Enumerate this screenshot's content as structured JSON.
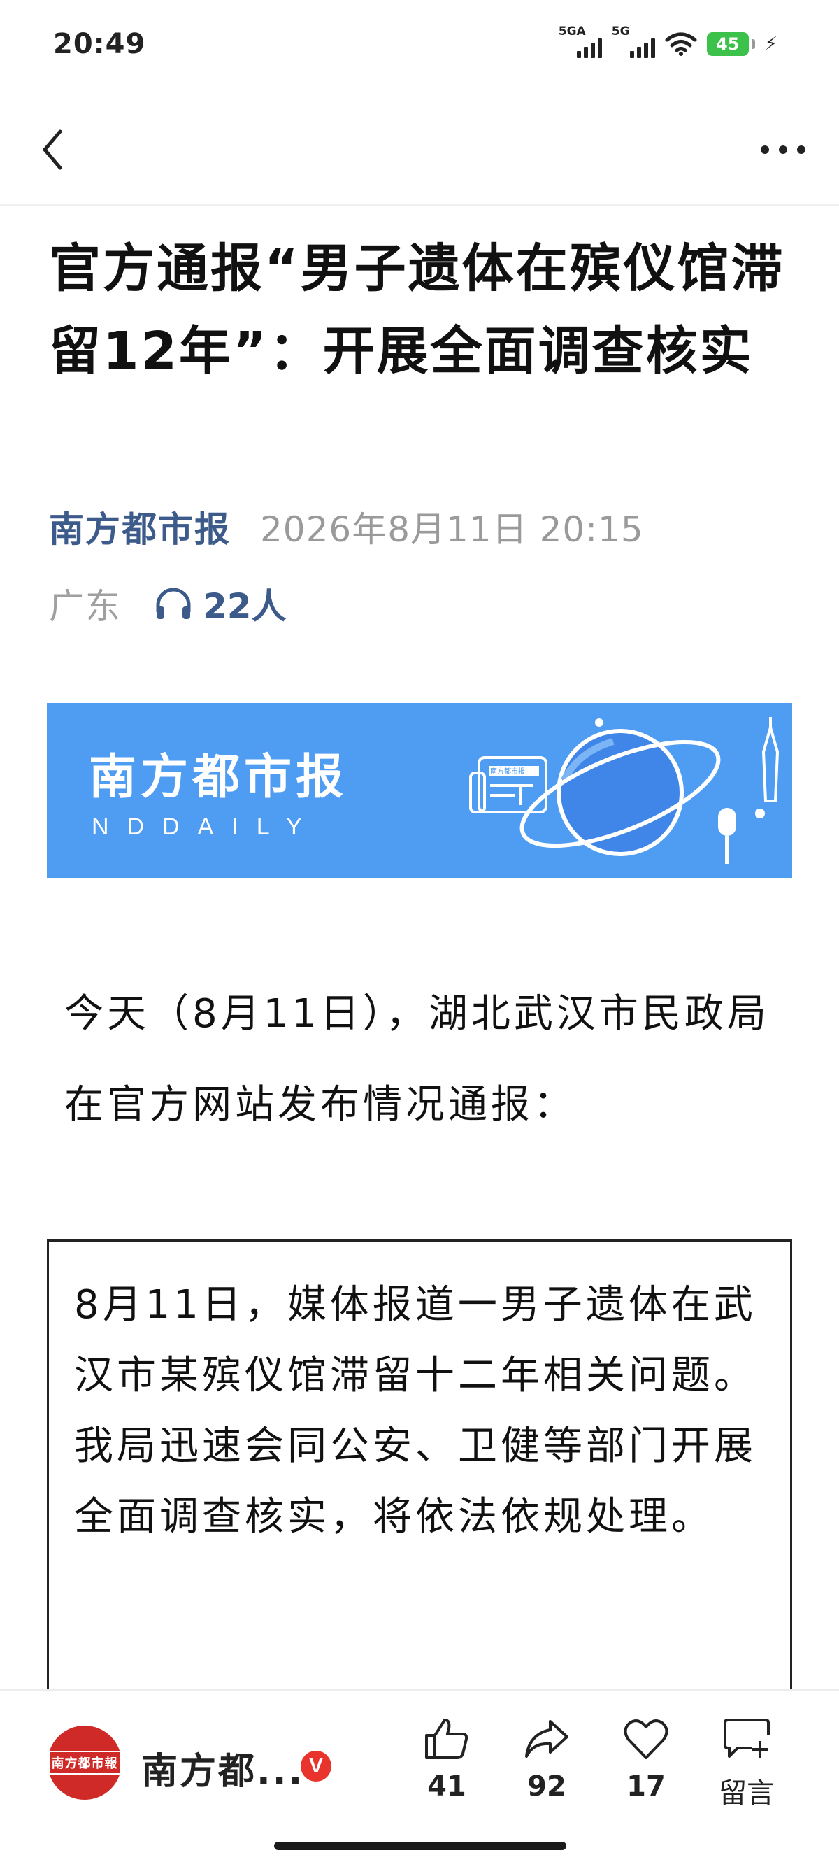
{
  "status_bar": {
    "time": "20:49",
    "signal1_label": "5GA",
    "signal2_label": "5G",
    "battery_level": "45",
    "icons": [
      "signal-icon",
      "signal-icon",
      "wifi-icon",
      "battery-icon",
      "charging-icon"
    ]
  },
  "nav": {
    "back_icon": "back-chevron-icon",
    "more_icon": "more-dots-icon"
  },
  "article": {
    "title": "官方通报“男子遗体在殡仪馆滞留12年”：开展全面调查核实",
    "source": "南方都市报",
    "datetime": "2026年8月11日 20:15",
    "region": "广东",
    "listeners": "22人",
    "banner": {
      "name": "南方都市报",
      "english": "NDDAILY",
      "newspaper_mark": "南方都市报"
    },
    "intro": "今天（8月11日），湖北武汉市民政局在官方网站发布情况通报：",
    "notice": "8月11日，媒体报道一男子遗体在武汉市某殡仪馆滞留十二年相关问题。我局迅速会同公安、卫健等部门开展全面调查核实，将依法依规处理。"
  },
  "action_bar": {
    "publisher_name": "南方都...",
    "verified_badge": "V",
    "avatar_mark": "南方都市報",
    "likes": "41",
    "shares": "92",
    "favorites": "17",
    "comment_label": "留言"
  },
  "colors": {
    "source_blue": "#3c5a8a",
    "banner_blue": "#4f9cf3",
    "battery_green": "#3cc24a",
    "avatar_red": "#cf2a27",
    "verified_red": "#e8342d"
  }
}
